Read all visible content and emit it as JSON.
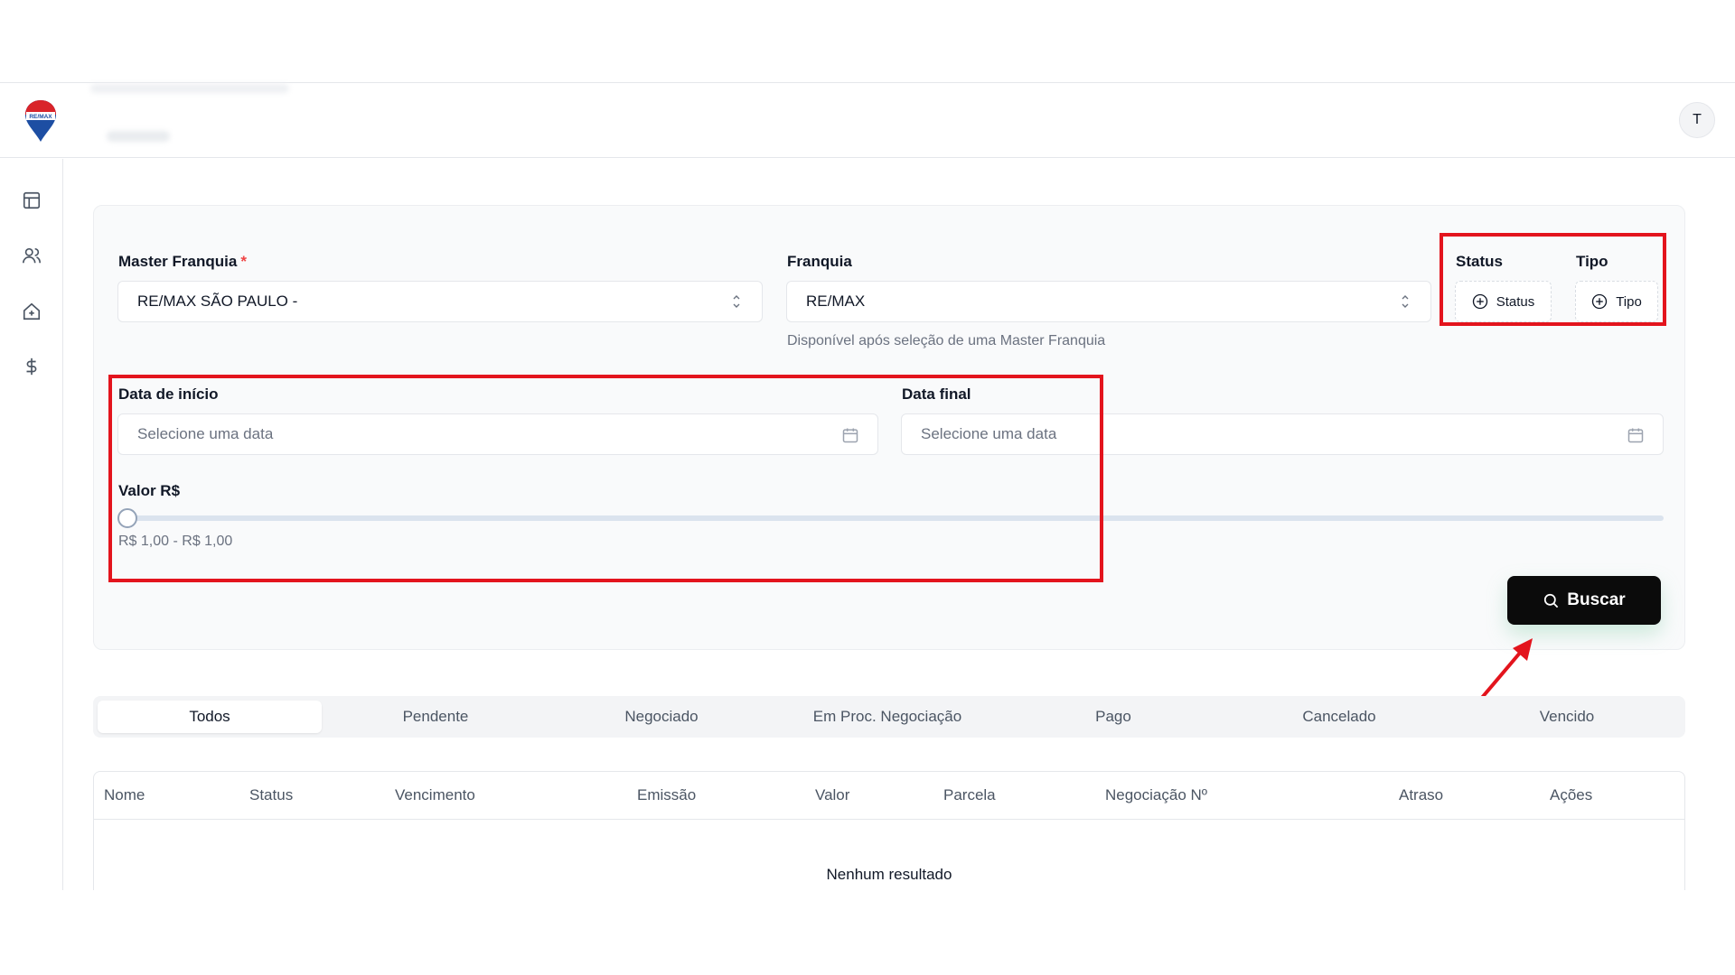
{
  "header": {
    "logo_text": "RE/MAX",
    "avatar_initial": "T"
  },
  "sidebar": {
    "items": [
      {
        "icon": "layout-icon"
      },
      {
        "icon": "users-icon"
      },
      {
        "icon": "house-plus-icon"
      },
      {
        "icon": "dollar-icon"
      }
    ]
  },
  "filters": {
    "master_franquia": {
      "label": "Master Franquia",
      "required_mark": "*",
      "value": "RE/MAX SÃO PAULO -"
    },
    "franquia": {
      "label": "Franquia",
      "value": "RE/MAX",
      "hint": "Disponível após seleção de uma Master Franquia"
    },
    "status": {
      "label": "Status",
      "chip": "Status"
    },
    "tipo": {
      "label": "Tipo",
      "chip": "Tipo"
    },
    "data_inicio": {
      "label": "Data de início",
      "placeholder": "Selecione uma data"
    },
    "data_final": {
      "label": "Data final",
      "placeholder": "Selecione uma data"
    },
    "valor": {
      "label": "Valor R$",
      "range_text": "R$ 1,00 - R$ 1,00",
      "slider_fraction": 0
    },
    "search_button": "Buscar"
  },
  "tabs": [
    "Todos",
    "Pendente",
    "Negociado",
    "Em Proc. Negociação",
    "Pago",
    "Cancelado",
    "Vencido"
  ],
  "active_tab": "Todos",
  "table": {
    "columns": [
      "Nome",
      "Status",
      "Vencimento",
      "Emissão",
      "Valor",
      "Parcela",
      "Negociação Nº",
      "Atraso",
      "Ações"
    ],
    "empty_text": "Nenhum resultado"
  },
  "colors": {
    "highlight": "#e3141d",
    "button": "#0b0b0b"
  }
}
